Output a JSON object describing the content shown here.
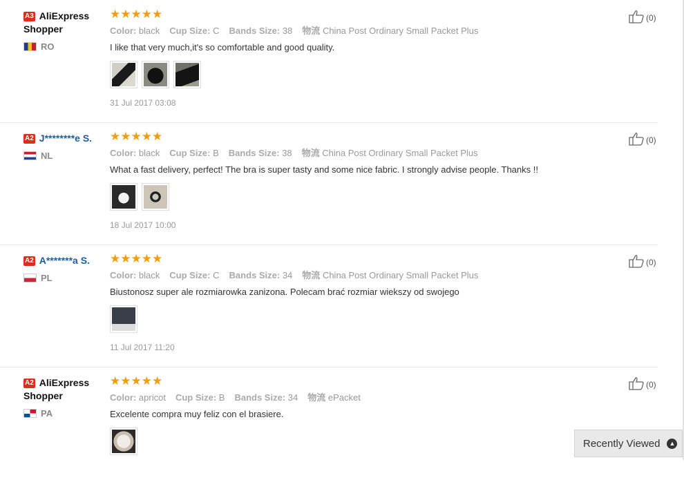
{
  "reviews": [
    {
      "level": "A3",
      "name": "AliExpress Shopper",
      "masked": false,
      "country": "RO",
      "flag": "flag-ro",
      "stars": "★★★★★",
      "attrs": [
        {
          "key": "Color:",
          "value": "black"
        },
        {
          "key": "Cup Size:",
          "value": "C"
        },
        {
          "key": "Bands Size:",
          "value": "38"
        },
        {
          "key": "物流",
          "value": "China Post Ordinary Small Packet Plus"
        }
      ],
      "text": "I like that very much,it's so comfortable and good quality.",
      "thumbs": [
        "t-dark1",
        "t-dark2",
        "t-dark3"
      ],
      "date": "31 Jul 2017 03:08",
      "likes": "(0)"
    },
    {
      "level": "A2",
      "name": "J********e S.",
      "masked": true,
      "country": "NL",
      "flag": "flag-nl",
      "stars": "★★★★★",
      "attrs": [
        {
          "key": "Color:",
          "value": "black"
        },
        {
          "key": "Cup Size:",
          "value": "B"
        },
        {
          "key": "Bands Size:",
          "value": "38"
        },
        {
          "key": "物流",
          "value": "China Post Ordinary Small Packet Plus"
        }
      ],
      "text": "What a fast delivery, perfect! The bra is super tasty and some nice fabric. I strongly advise people. Thanks !!",
      "thumbs": [
        "t-white",
        "t-bra"
      ],
      "date": "18 Jul 2017 10:00",
      "likes": "(0)"
    },
    {
      "level": "A2",
      "name": "A*******a S.",
      "masked": true,
      "country": "PL",
      "flag": "flag-pl",
      "stars": "★★★★★",
      "attrs": [
        {
          "key": "Color:",
          "value": "black"
        },
        {
          "key": "Cup Size:",
          "value": "C"
        },
        {
          "key": "Bands Size:",
          "value": "34"
        },
        {
          "key": "物流",
          "value": "China Post Ordinary Small Packet Plus"
        }
      ],
      "text": "Biustonosz super ale rozmiarowka zanizona. Polecam brać rozmiar wiekszy od swojego",
      "thumbs": [
        "t-gray"
      ],
      "date": "11 Jul 2017 11:20",
      "likes": "(0)"
    },
    {
      "level": "A2",
      "name": "AliExpress Shopper",
      "masked": false,
      "country": "PA",
      "flag": "flag-pa",
      "stars": "★★★★★",
      "attrs": [
        {
          "key": "Color:",
          "value": "apricot"
        },
        {
          "key": "Cup Size:",
          "value": "B"
        },
        {
          "key": "Bands Size:",
          "value": "34"
        },
        {
          "key": "物流",
          "value": "ePacket"
        }
      ],
      "text": "Excelente compra muy feliz con el brasiere.",
      "thumbs": [
        "t-cream"
      ],
      "date": "",
      "likes": "(0)"
    }
  ],
  "recently_viewed": {
    "label": "Recently Viewed"
  },
  "colors": {
    "accent": "#d9301d",
    "stars": "#f39c0f",
    "link": "#1c5e9e"
  },
  "icons": {
    "like": "thumbs-up-icon",
    "expand": "chevron-up-icon"
  }
}
